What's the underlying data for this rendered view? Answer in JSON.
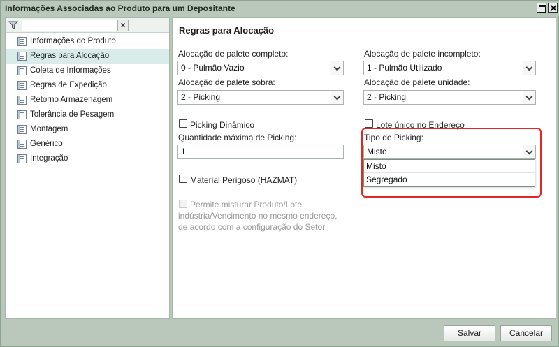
{
  "window": {
    "title": "Informações Associadas ao Produto para um Depositante"
  },
  "filter": {
    "value": "",
    "clear_label": "×"
  },
  "nav": {
    "items": [
      {
        "label": "Informações do Produto"
      },
      {
        "label": "Regras para Alocação"
      },
      {
        "label": "Coleta de Informações"
      },
      {
        "label": "Regras de Expedição"
      },
      {
        "label": "Retorno Armazenagem"
      },
      {
        "label": "Tolerância de Pesagem"
      },
      {
        "label": "Montagem"
      },
      {
        "label": "Genérico"
      },
      {
        "label": "Integração"
      }
    ],
    "active_index": 1
  },
  "section": {
    "title": "Regras para Alocação"
  },
  "form": {
    "palete_completo": {
      "label": "Alocação de palete completo:",
      "value": "0 - Pulmão Vazio"
    },
    "palete_incompleto": {
      "label": "Alocação de palete incompleto:",
      "value": "1 - Pulmão Utilizado"
    },
    "palete_sobra": {
      "label": "Alocação de palete sobra:",
      "value": "2 - Picking"
    },
    "palete_unidade": {
      "label": "Alocação de palete unidade:",
      "value": "2 - Picking"
    },
    "picking_dinamico": {
      "label": "Picking Dinâmico",
      "checked": false
    },
    "lote_unico": {
      "label": "Lote único no Endereço",
      "checked": false
    },
    "qtd_max_picking": {
      "label": "Quantidade máxima de Picking:",
      "value": "1"
    },
    "tipo_picking": {
      "label": "Tipo de Picking:",
      "value": "Misto",
      "options": [
        "Misto",
        "Segregado"
      ]
    },
    "hazmat": {
      "label": "Material Perigoso (HAZMAT)",
      "checked": false
    },
    "misturar": {
      "line1": "Permite misturar Produto/Lote",
      "line2": "indústria/Vencimento no mesmo endereço,",
      "line3": "de acordo com a configuração do Setor",
      "checked": false,
      "enabled": false
    }
  },
  "footer": {
    "save_label": "Salvar",
    "cancel_label": "Cancelar"
  },
  "colors": {
    "frame": "#b9c8bb",
    "active_nav": "#d9ecea",
    "highlight": "#e32626"
  }
}
